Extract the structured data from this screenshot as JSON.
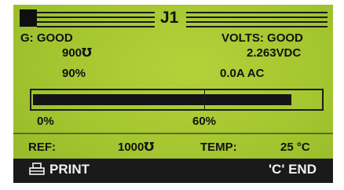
{
  "header": {
    "title": "J1"
  },
  "status": {
    "ground": "G: GOOD",
    "ground_value": "900℧",
    "ground_percent": "90%",
    "volts": "VOLTS: GOOD",
    "volts_value": "2.263VDC",
    "current_value": "0.0A  AC"
  },
  "bar": {
    "fill_percent": 90,
    "marker_percent": 60,
    "label_min": "0%",
    "label_marker": "60%"
  },
  "footer_info": {
    "ref_label": "REF:",
    "ref_value": "1000℧",
    "temp_label": "TEMP:",
    "temp_value": "25 °C"
  },
  "softkeys": {
    "print_label": "PRINT",
    "end_label": "'C' END",
    "print_icon": "printer-icon"
  },
  "colors": {
    "lcd_background": "#a2c22e",
    "lcd_foreground": "#141414"
  }
}
